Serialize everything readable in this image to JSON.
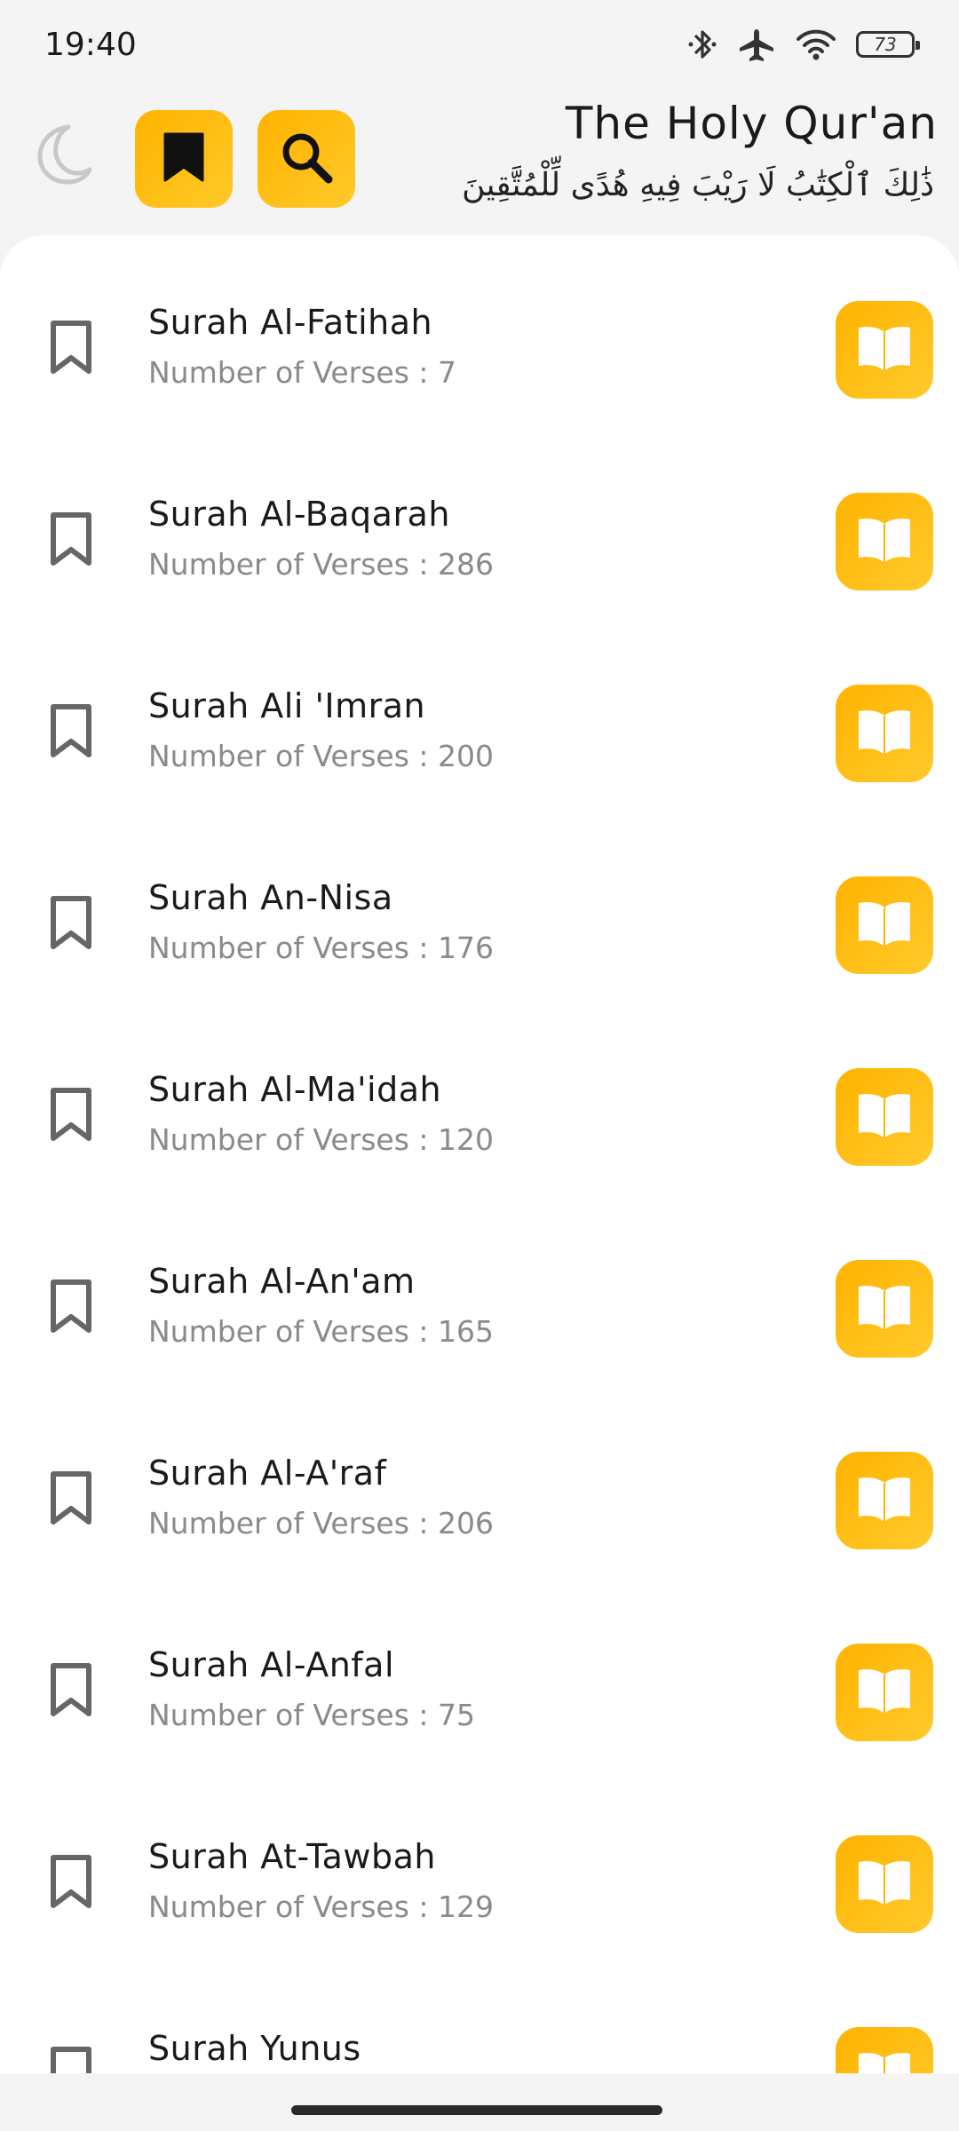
{
  "status_bar": {
    "time": "19:40",
    "battery": "73",
    "icons": [
      "bluetooth-icon",
      "airplane-icon",
      "wifi-icon",
      "battery-icon"
    ]
  },
  "header": {
    "title": "The Holy Qur'an",
    "subtitle": "ذَٰلِكَ ٱلْكِتَٰبُ لَا رَيْبَ فِيهِ هُدًى لِّلْمُتَّقِينَ",
    "buttons": [
      "moon-icon",
      "bookmark-icon",
      "search-icon"
    ]
  },
  "colors": {
    "accent": "#ffb300",
    "background": "#f4f4f4",
    "card": "#ffffff",
    "secondary_text": "#8a8a8a"
  },
  "surahs": [
    {
      "name": "Surah Al-Fatihah",
      "verses": "Number of Verses : 7"
    },
    {
      "name": "Surah Al-Baqarah",
      "verses": "Number of Verses : 286"
    },
    {
      "name": "Surah Ali 'Imran",
      "verses": "Number of Verses : 200"
    },
    {
      "name": "Surah An-Nisa",
      "verses": "Number of Verses : 176"
    },
    {
      "name": "Surah Al-Ma'idah",
      "verses": "Number of Verses : 120"
    },
    {
      "name": "Surah Al-An'am",
      "verses": "Number of Verses : 165"
    },
    {
      "name": "Surah Al-A'raf",
      "verses": "Number of Verses : 206"
    },
    {
      "name": "Surah Al-Anfal",
      "verses": "Number of Verses : 75"
    },
    {
      "name": "Surah At-Tawbah",
      "verses": "Number of Verses : 129"
    },
    {
      "name": "Surah Yunus",
      "verses": ""
    }
  ]
}
